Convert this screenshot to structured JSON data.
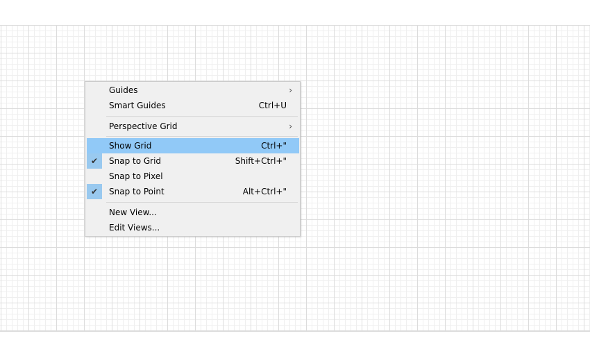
{
  "menu": {
    "items": [
      {
        "label": "Guides",
        "shortcut": "",
        "submenu": true
      },
      {
        "label": "Smart Guides",
        "shortcut": "Ctrl+U"
      },
      {
        "label": "Perspective Grid",
        "shortcut": "",
        "submenu": true
      },
      {
        "label": "Show Grid",
        "shortcut": "Ctrl+\"",
        "highlighted": true
      },
      {
        "label": "Snap to Grid",
        "shortcut": "Shift+Ctrl+\"",
        "checked": true
      },
      {
        "label": "Snap to Pixel",
        "shortcut": ""
      },
      {
        "label": "Snap to Point",
        "shortcut": "Alt+Ctrl+\"",
        "checked": true
      },
      {
        "label": "New View...",
        "shortcut": ""
      },
      {
        "label": "Edit Views...",
        "shortcut": ""
      }
    ],
    "submenu_arrow": "›",
    "check_glyph": "✔"
  },
  "colors": {
    "highlight": "#91c9f7",
    "check_bg": "#99c9ef"
  }
}
